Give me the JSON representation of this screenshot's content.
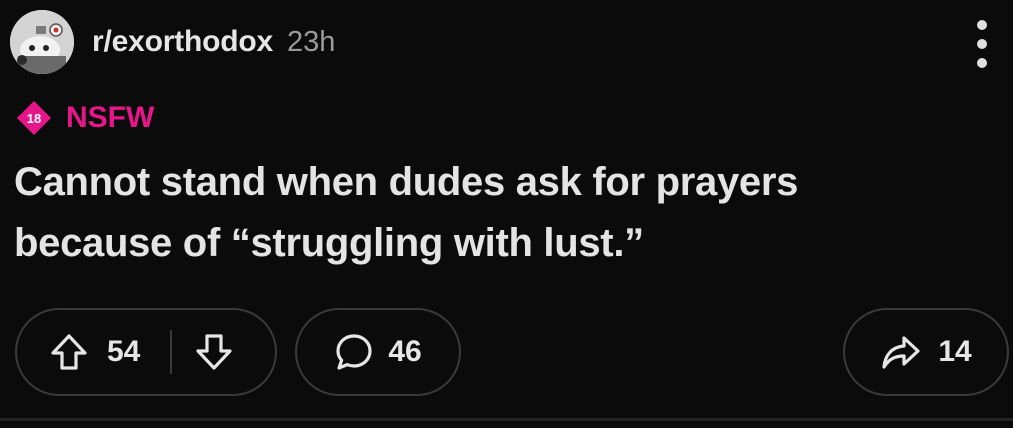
{
  "post": {
    "subreddit": "r/exorthodox",
    "age": "23h",
    "nsfw_badge": "18",
    "nsfw_label": "NSFW",
    "title": "Cannot stand when dudes ask for prayers because of “struggling with lust.”"
  },
  "actions": {
    "upvotes": "54",
    "comments": "46",
    "shares": "14"
  },
  "colors": {
    "background": "#0b0b0b",
    "nsfw": "#e6168a",
    "pill_border": "#3a3a3a",
    "text": "#e4e4e4",
    "muted": "#9a9a9a"
  },
  "icons": {
    "avatar": "snoo-avatar-icon",
    "more": "more-vertical-icon",
    "nsfw": "nsfw-diamond-icon",
    "upvote": "upvote-arrow-icon",
    "downvote": "downvote-arrow-icon",
    "comment": "comment-bubble-icon",
    "share": "share-arrow-icon"
  }
}
